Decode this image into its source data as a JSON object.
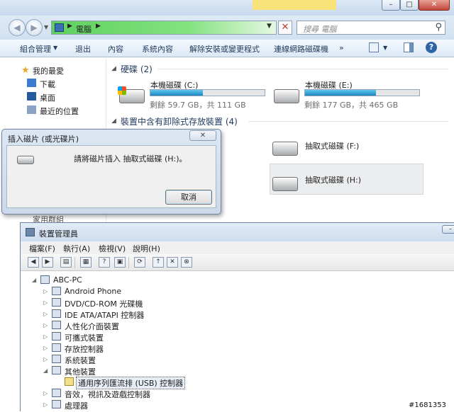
{
  "explorer": {
    "address": {
      "location": "電腦"
    },
    "search_placeholder": "搜尋 電腦",
    "toolbar": {
      "organize": "組合管理",
      "eject": "退出",
      "properties": "內容",
      "system_properties": "系統內容",
      "uninstall": "解除安裝或變更程式",
      "map_drive": "連線網路磁碟機",
      "more": "»"
    },
    "sidebar": {
      "favorites": "我的最愛",
      "items": [
        "下載",
        "桌面",
        "最近的位置"
      ],
      "homegroup": "家用群組"
    },
    "hard_disks": {
      "title": "硬碟 (2)",
      "drives": [
        {
          "name": "本機磁碟 (C:)",
          "detail": "剩餘 59.7 GB，共 111 GB",
          "used_fraction": 0.46
        },
        {
          "name": "本機磁碟 (E:)",
          "detail": "剩餘 177 GB，共 465 GB",
          "used_fraction": 0.62
        }
      ]
    },
    "removable": {
      "title": "裝置中含有卸除式存放裝置 (4)",
      "drives": [
        {
          "name": "抽取式磁碟 (F:)"
        },
        {
          "name": "抽取式磁碟 (H:)"
        }
      ]
    }
  },
  "dialog": {
    "title": "插入磁片 (或光碟片)",
    "message": "請將磁片插入 抽取式磁碟 (H:)。",
    "cancel": "取消"
  },
  "device_manager": {
    "title": "裝置管理員",
    "menu": [
      "檔案(F)",
      "執行(A)",
      "檢視(V)",
      "說明(H)"
    ],
    "tree": {
      "root": "ABC-PC",
      "nodes": [
        "Android Phone",
        "DVD/CD-ROM 光碟機",
        "IDE ATA/ATAPI 控制器",
        "人性化介面裝置",
        "可攜式裝置",
        "存放控制器",
        "系統裝置",
        "其他裝置",
        "通用序列匯流排 (USB) 控制器",
        "音效，視訊及遊戲控制器",
        "處理器"
      ]
    }
  },
  "watermark": "#1681353"
}
